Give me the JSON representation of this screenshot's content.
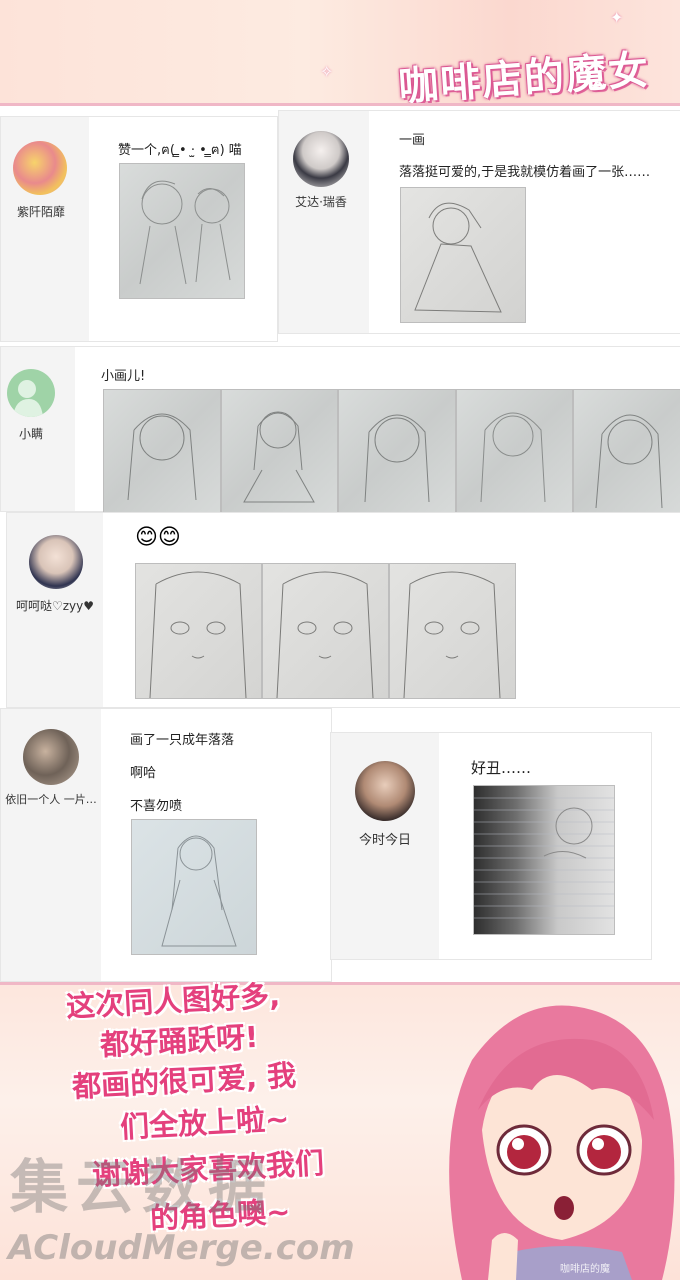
{
  "header": {
    "title": "咖啡店的魔女"
  },
  "comments": [
    {
      "user": "紫阡陌靡",
      "text": "赞一个,ฅ( ̳• ·̫ • ̳ฅ) 喵"
    },
    {
      "user": "艾达·瑞香",
      "lines": [
        "一画",
        "落落挺可爱的,于是我就模仿着画了一张……"
      ]
    },
    {
      "user": "小瞒",
      "text": "小画儿!"
    },
    {
      "user": "呵呵哒♡zyy♥",
      "text": "😊😊"
    },
    {
      "user": "依旧一个人 一片…",
      "lines": [
        "画了一只成年落落",
        "啊哈",
        "不喜勿喷"
      ]
    },
    {
      "user": "今时今日",
      "text": "好丑……"
    }
  ],
  "message": {
    "lines": [
      "这次同人图好多,",
      "都好踊跃呀!",
      "都画的很可爱, 我",
      "们全放上啦~",
      "谢谢大家喜欢我们",
      "的角色噢~"
    ]
  },
  "watermark": {
    "cn": "集云数据",
    "en": "ACloudMerge.com",
    "small": "咖啡店的魔"
  }
}
